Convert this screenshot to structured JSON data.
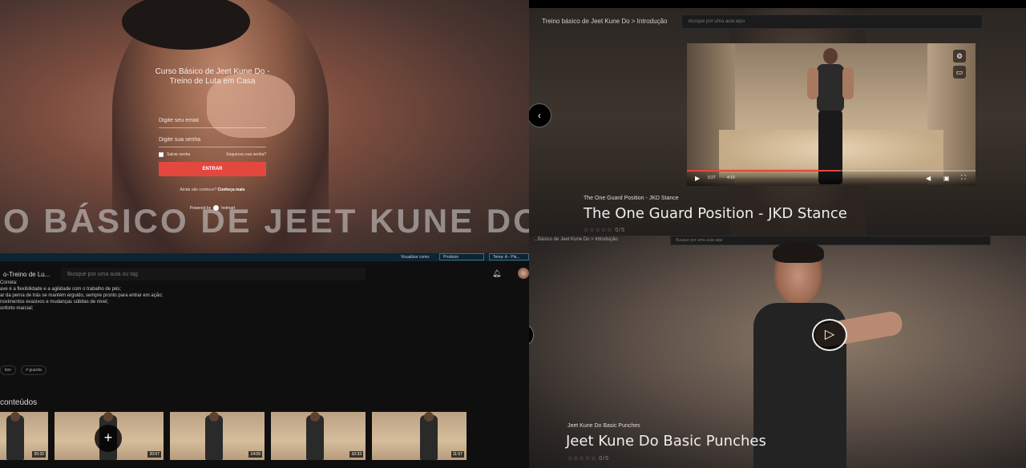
{
  "login": {
    "course_title": "Curso Básico de Jeet Kune Do -Treino de Luta em Casa",
    "email_placeholder": "Digite seu email",
    "password_placeholder": "Digite sua senha",
    "remember_label": "Salvar senha",
    "forgot_label": "Esqueceu sua senha?",
    "submit_label": "ENTRAR",
    "meet_text": "Ainda não conhece?",
    "meet_link": "Conheça mais",
    "powered_by": "Powered by",
    "brand": "hotmart",
    "banner": "O BÁSICO DE JEET KUNE DO"
  },
  "video": {
    "breadcrumb": "Treino básico de Jeet Kune Do > Introdução",
    "search_placeholder": "Busque por uma aula aqui",
    "back_icon": "chevron-left-icon",
    "subtitle": "The One Guard Position - JKD Stance",
    "title": "The One Guard Position - JKD Stance",
    "time_current": "0:27",
    "time_total": "4:15",
    "progress": 0.53,
    "stars": "☆☆☆☆☆",
    "rating_count": "0/5"
  },
  "course": {
    "top_bar": {
      "view_label": "Visualizar como:",
      "view_value": "Produtor",
      "theme_label": "Tema: A - Pla..."
    },
    "name": "o-Treino de Lu...",
    "search_placeholder": "Busque por uma aula ou tag",
    "description_lines": [
      "Correta:",
      "",
      "ave é a flexibilidade e a agilidade com o trabalho de pés;",
      "ar da perna de trás se mantém erguido, sempre pronto para entrar em ação;",
      "novimentos evasivos e mudanças súbitas de nível;",
      "onforto marcial;"
    ],
    "tags": [
      "tion",
      "# guarda"
    ],
    "contents_title": "conteúdos",
    "thumbs": [
      {
        "duration": "20:32"
      },
      {
        "duration": "20:07"
      },
      {
        "duration": "14:09"
      },
      {
        "duration": "10:33"
      },
      {
        "duration": "11:57"
      }
    ]
  },
  "punch": {
    "breadcrumb": "...Básico de Jeet Kune Do > Introdução",
    "search_placeholder": "Busque por uma aula aqui",
    "subtitle": "Jeet Kune Do Basic Punches",
    "title": "Jeet Kune Do Basic Punches",
    "stars": "☆☆☆☆☆",
    "rating_count": "0/5"
  },
  "colors": {
    "accent": "#e4473e",
    "strip": "#0d2433"
  }
}
